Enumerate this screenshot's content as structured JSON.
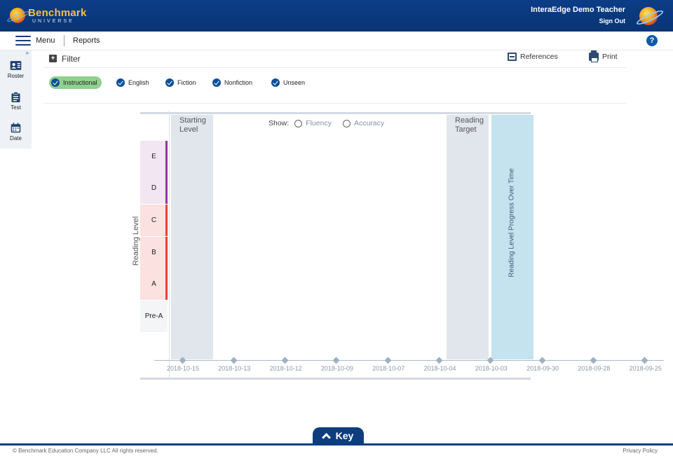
{
  "header": {
    "brand": "Benchmark",
    "brand_sub": "UNIVERSE",
    "user_name": "InteraEdge Demo Teacher",
    "sign_out": "Sign Out"
  },
  "menubar": {
    "menu_label": "Menu",
    "reports_label": "Reports",
    "help": "?"
  },
  "sidebar": {
    "toggle": "»",
    "items": [
      {
        "label": "Roster",
        "icon": "roster-icon"
      },
      {
        "label": "Test",
        "icon": "clipboard-icon"
      },
      {
        "label": "Date",
        "icon": "calendar-icon"
      }
    ]
  },
  "filter": {
    "plus": "+",
    "label": "Filter",
    "references": "References",
    "print": "Print"
  },
  "chips": [
    {
      "label": "Instructional",
      "active": true
    },
    {
      "label": "English",
      "active": false
    },
    {
      "label": "Fiction",
      "active": false
    },
    {
      "label": "Nonfiction",
      "active": false
    },
    {
      "label": "Unseen",
      "active": false
    }
  ],
  "chart": {
    "y_title": "Reading Level",
    "levels": [
      {
        "label": "E",
        "bg": "#f2e6f3",
        "bar": "#8e3a96"
      },
      {
        "label": "D",
        "bg": "#f2e6f3",
        "bar": "#8e3a96"
      },
      {
        "label": "C",
        "bg": "#fbe1e0",
        "bar": "#e2433a"
      },
      {
        "label": "B",
        "bg": "#fbe1e0",
        "bar": "#e2433a"
      },
      {
        "label": "A",
        "bg": "#fbe1e0",
        "bar": "#e2433a"
      },
      {
        "label": "Pre-A",
        "bg": "#f4f5f7",
        "bar": "#f4f5f7"
      }
    ],
    "starting_level_line1": "Starting",
    "starting_level_line2": "Level",
    "reading_target_line1": "Reading",
    "reading_target_line2": "Target",
    "progress_title": "Reading Level Progress Over Time",
    "show_label": "Show:",
    "radio_fluency": "Fluency",
    "radio_accuracy": "Accuracy",
    "x_dates": [
      "2018-10-15",
      "2018-10-13",
      "2018-10-12",
      "2018-10-09",
      "2018-10-07",
      "2018-10-04",
      "2018-10-03",
      "2018-09-30",
      "2018-09-28",
      "2018-09-25"
    ]
  },
  "key": {
    "label": "Key"
  },
  "footer": {
    "copyright": "© Benchmark Education Company LLC All rights reserved.",
    "privacy": "Privacy Policy"
  },
  "colors": {
    "brand_blue": "#0b3d86",
    "active_chip": "#8fd18d",
    "check_blue": "#0e4f98",
    "band_gray": "#e1e5ec",
    "target_blue": "#c5e3ee"
  }
}
